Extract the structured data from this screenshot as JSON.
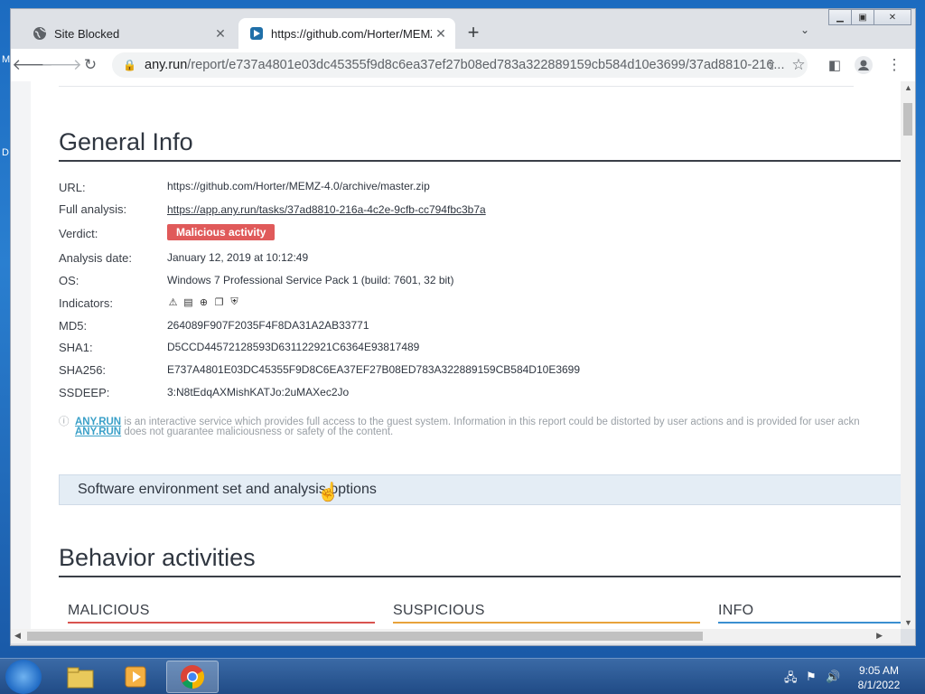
{
  "desktop": {
    "label_top": "M",
    "label_mid": "D"
  },
  "tabs": [
    {
      "title": "Site Blocked",
      "close": "✕"
    },
    {
      "title": "https://github.com/Horter/MEMZ",
      "close": "✕"
    }
  ],
  "toolbar": {
    "new_tab": "+",
    "tab_menu": "⌄",
    "url_host": "any.run",
    "url_path": "/report/e737a4801e03dc45355f9d8c6ea37ef27b08ed783a322889159cb584d10e3699/37ad8810-216..."
  },
  "general": {
    "title": "General Info",
    "rows": {
      "url_label": "URL:",
      "url_value": "https://github.com/Horter/MEMZ-4.0/archive/master.zip",
      "full_label": "Full analysis:",
      "full_value": "https://app.any.run/tasks/37ad8810-216a-4c2e-9cfb-cc794fbc3b7a",
      "verdict_label": "Verdict:",
      "verdict_value": "Malicious activity",
      "date_label": "Analysis date:",
      "date_value": "January 12, 2019 at 10:12:49",
      "os_label": "OS:",
      "os_value": "Windows 7 Professional Service Pack 1 (build: 7601, 32 bit)",
      "ind_label": "Indicators:",
      "md5_label": "MD5:",
      "md5_value": "264089F907F2035F4F8DA31A2AB33771",
      "sha1_label": "SHA1:",
      "sha1_value": "D5CCD44572128593D631122921C6364E93817489",
      "sha256_label": "SHA256:",
      "sha256_value": "E737A4801E03DC45355F9D8C6EA37EF27B08ED783A322889159CB584D10E3699",
      "ssdeep_label": "SSDEEP:",
      "ssdeep_value": "3:N8tEdqAXMishKATJo:2uMAXec2Jo"
    },
    "indicators": [
      "warning-icon",
      "executable-icon",
      "network-icon",
      "copy-icon",
      "shield-icon"
    ],
    "note": {
      "link1": "ANY.RUN",
      "text1": " is an interactive service which provides full access to the guest system. Information in this report could be distorted by user actions and is provided for user ackn",
      "link2": "ANY.RUN",
      "text2": " does not guarantee maliciousness or safety of the content."
    },
    "env_bar": "Software environment set and analysis options"
  },
  "behavior": {
    "title": "Behavior activities",
    "cols": [
      {
        "label": "MALICIOUS",
        "color": "#d9534f"
      },
      {
        "label": "SUSPICIOUS",
        "color": "#e8a23a"
      },
      {
        "label": "INFO",
        "color": "#3a8fd0"
      }
    ]
  },
  "taskbar": {
    "time": "9:05 AM",
    "date": "8/1/2022"
  }
}
